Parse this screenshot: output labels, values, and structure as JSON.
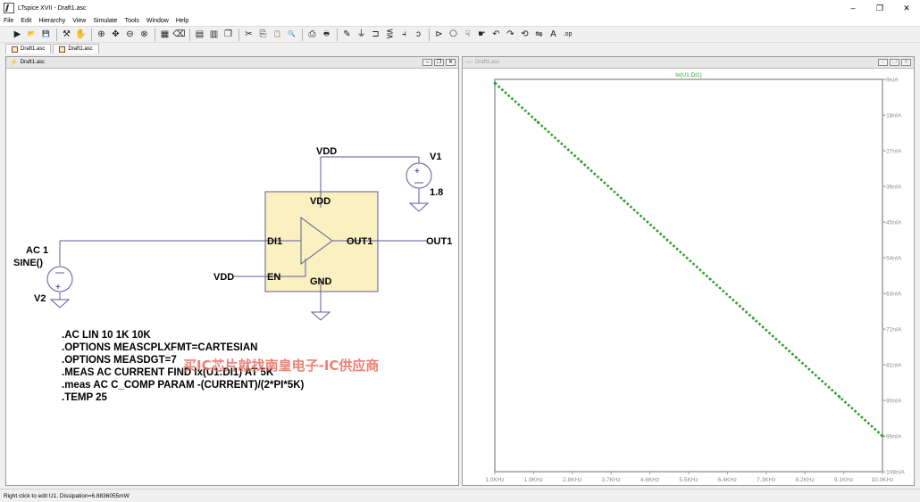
{
  "app": {
    "title": "LTspice XVII - Draft1.asc"
  },
  "window_controls": {
    "minimize": "–",
    "maximize": "❐",
    "close": "✕"
  },
  "menu": [
    "File",
    "Edit",
    "Hierarchy",
    "View",
    "Simulate",
    "Tools",
    "Window",
    "Help"
  ],
  "toolbar": [
    {
      "name": "run-icon",
      "glyph": "▶"
    },
    {
      "name": "open-icon",
      "glyph": "📂"
    },
    {
      "name": "save-icon",
      "glyph": "💾"
    },
    {
      "sep": true
    },
    {
      "name": "control-panel-icon",
      "glyph": "⚒"
    },
    {
      "name": "halt-icon",
      "glyph": "✋"
    },
    {
      "sep": true
    },
    {
      "name": "zoom-in-icon",
      "glyph": "⊕"
    },
    {
      "name": "pan-icon",
      "glyph": "✥"
    },
    {
      "name": "zoom-out-icon",
      "glyph": "⊖"
    },
    {
      "name": "zoom-fit-icon",
      "glyph": "⊗"
    },
    {
      "sep": true
    },
    {
      "name": "autorange-icon",
      "glyph": "▦"
    },
    {
      "name": "erase-icon",
      "glyph": "⌫"
    },
    {
      "sep": true
    },
    {
      "name": "tile-horizontal-icon",
      "glyph": "▤"
    },
    {
      "name": "tile-vertical-icon",
      "glyph": "▥"
    },
    {
      "name": "cascade-icon",
      "glyph": "❐"
    },
    {
      "sep": true
    },
    {
      "name": "cut-icon",
      "glyph": "✂"
    },
    {
      "name": "copy-icon",
      "glyph": "⎘"
    },
    {
      "name": "paste-icon",
      "glyph": "📋"
    },
    {
      "name": "find-icon",
      "glyph": "🔍"
    },
    {
      "sep": true
    },
    {
      "name": "print-setup-icon",
      "glyph": "⎙"
    },
    {
      "name": "print-icon",
      "glyph": "🖶"
    },
    {
      "sep": true
    },
    {
      "name": "wire-icon",
      "glyph": "✎"
    },
    {
      "name": "ground-icon",
      "glyph": "⏚"
    },
    {
      "name": "label-net-icon",
      "glyph": "⊐"
    },
    {
      "name": "resistor-icon",
      "glyph": "⋚"
    },
    {
      "name": "capacitor-icon",
      "glyph": "⫞"
    },
    {
      "name": "inductor-icon",
      "glyph": "ↄ"
    },
    {
      "sep": true
    },
    {
      "name": "diode-icon",
      "glyph": "⊳"
    },
    {
      "name": "component-icon",
      "glyph": "⎔"
    },
    {
      "name": "move-icon",
      "glyph": "☟"
    },
    {
      "name": "drag-icon",
      "glyph": "☛"
    },
    {
      "name": "undo-icon",
      "glyph": "↶"
    },
    {
      "name": "redo-icon",
      "glyph": "↷"
    },
    {
      "name": "rotate-icon",
      "glyph": "⟲"
    },
    {
      "name": "mirror-icon",
      "glyph": "⇋"
    },
    {
      "name": "text-icon",
      "glyph": "A"
    },
    {
      "name": "spice-directive-icon",
      "glyph": ".op"
    }
  ],
  "tabs": [
    {
      "label": "Draft1.asc"
    },
    {
      "label": "Draft1.asc"
    }
  ],
  "schematic_window": {
    "title": "Draft1.asc",
    "labels": {
      "vdd_top": "VDD",
      "v1_name": "V1",
      "v1_value": "1.8",
      "u1_vdd": "VDD",
      "u1_di1": "DI1",
      "u1_out1": "OUT1",
      "u1_en": "EN",
      "u1_gnd": "GND",
      "out1_net": "OUT1",
      "vdd_en": "VDD",
      "v2_ac": "AC 1",
      "v2_sine": "SINE()",
      "v2_name": "V2"
    },
    "directives": [
      ".AC LIN 10 1K 10K",
      ".OPTIONS MEASCPLXFMT=CARTESIAN",
      ".OPTIONS MEASDGT=7",
      ".MEAS AC CURRENT FIND Ix(U1:DI1) AT 5K",
      ".meas AC C_COMP PARAM -(CURRENT)/(2*PI*5K)",
      ".TEMP 25"
    ],
    "watermark": "买IC芯片就找南皇电子-IC供应商"
  },
  "waveform_window": {
    "title": "Draft1.asc"
  },
  "chart_data": {
    "type": "line",
    "title": "Ix(U1:DI1)",
    "series_color": "#2ca02c",
    "x_tick_labels": [
      "1.0KHz",
      "1.9KHz",
      "2.8KHz",
      "3.7KHz",
      "4.6KHz",
      "5.5KHz",
      "6.4KHz",
      "7.3KHz",
      "8.2KHz",
      "9.1KHz",
      "10.0KHz"
    ],
    "y_tick_labels": [
      "-9nIA",
      "-18nIA",
      "-27nIA",
      "-36nIA",
      "-45nIA",
      "-54nIA",
      "-63nIA",
      "-72nIA",
      "-81nIA",
      "-90nIA",
      "-99nIA",
      "-108nIA"
    ],
    "xlim": [
      1000,
      10000
    ],
    "ylim": [
      -108,
      -9
    ],
    "x": [
      1000,
      2000,
      3000,
      4000,
      5000,
      6000,
      7000,
      8000,
      9000,
      10000
    ],
    "y": [
      -9.9,
      -19.8,
      -29.7,
      -39.6,
      -49.5,
      -59.4,
      -69.3,
      -79.2,
      -89.1,
      -99.0
    ],
    "line_style": "dotted",
    "grid": false
  },
  "status": {
    "text": "Right click to edit U1.   Dissipation=6.8836055mW"
  }
}
